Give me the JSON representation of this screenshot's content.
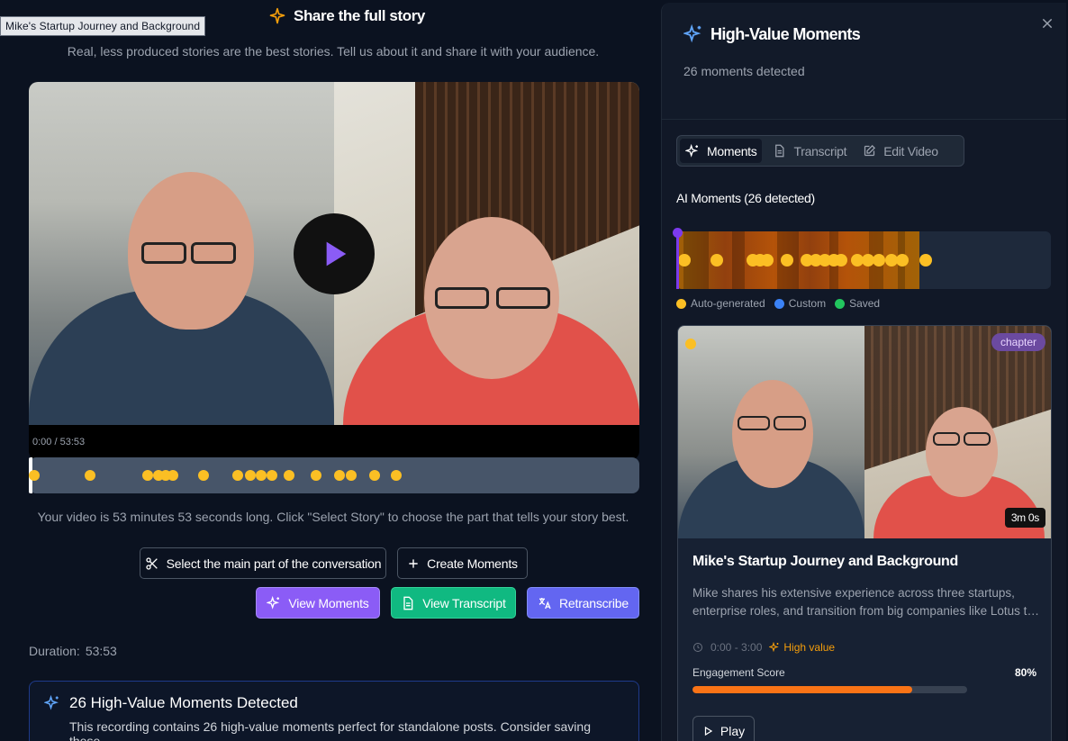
{
  "tooltip": "Mike's Startup Journey and Background",
  "header": {
    "title": "Share the full story",
    "subtitle": "Real, less produced stories are the best stories. Tell us about it and share it with your audience."
  },
  "player": {
    "time": "0:00 / 53:53",
    "timeline_markers_count": 19
  },
  "info_text": "Your video is 53 minutes 53 seconds long. Click \"Select Story\" to choose the part that tells your story best.",
  "buttons": {
    "select_main": "Select the main part of the conversation",
    "create_moments": "Create Moments",
    "view_moments": "View Moments",
    "view_transcript": "View Transcript",
    "retranscribe": "Retranscribe"
  },
  "duration": {
    "label": "Duration:",
    "value": "53:53"
  },
  "callout": {
    "title": "26 High-Value Moments Detected",
    "text": "This recording contains 26 high-value moments perfect for standalone posts. Consider saving these"
  },
  "panel": {
    "title": "High-Value Moments",
    "subtitle": "26 moments detected",
    "tabs": [
      "Moments",
      "Transcript",
      "Edit Video"
    ],
    "ai_label": "AI Moments (26 detected)",
    "legend": [
      {
        "label": "Auto-generated",
        "color": "#fbbf24"
      },
      {
        "label": "Custom",
        "color": "#3b82f6"
      },
      {
        "label": "Saved",
        "color": "#22c55e"
      }
    ],
    "card": {
      "badge": "chapter",
      "duration": "3m 0s",
      "title": "Mike's Startup Journey and Background",
      "description": "Mike shares his extensive experience across three startups, enterprise roles, and transition from big companies like Lotus to th...",
      "time_range": "0:00 - 3:00",
      "value_label": "High value",
      "engagement_label": "Engagement Score",
      "engagement_value": "80%",
      "engagement_fraction": 0.8,
      "play_label": "Play"
    }
  },
  "colors": {
    "accent": "#8b5cf6",
    "auto_generated": "#fbbf24",
    "engagement": "#f97316"
  }
}
